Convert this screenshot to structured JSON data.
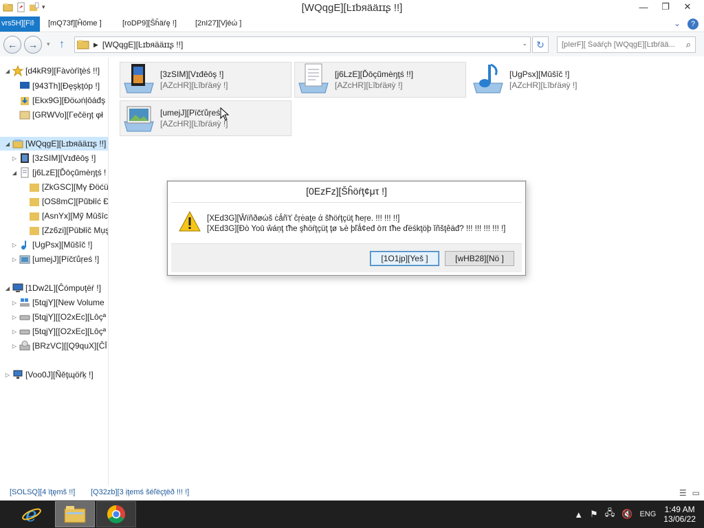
{
  "window": {
    "title": "[WQqgE][Ŀɪƅяääɪɪʂ !!]",
    "minimize_glyph": "—",
    "maximize_glyph": "❐",
    "close_glyph": "✕"
  },
  "ribbon": {
    "file_tab": "vrs5H][Fïŀ",
    "tabs": [
      "[mQ73f][Ĥömе ]",
      "[roDP9][Šĥäŕę !]",
      "[2nI27][Vĵéώ ]"
    ],
    "help_glyph": "?"
  },
  "nav": {
    "back_glyph": "←",
    "forward_glyph": "→",
    "up_glyph": "↑",
    "address_path": "[WQqgE][Ŀɪƅяääɪɪʂ !!]",
    "refresh_glyph": "↻",
    "search_placeholder": "[pIerF][ Šəäŕçĥ [WQqgE][Ŀɪƅŕää...",
    "search_icon_glyph": "⌕"
  },
  "tree": {
    "favorites": "[d4kR9][Fàvòŕîţèś !!]",
    "desktop": "[943Th][Ðęşķţóp !]",
    "downloads": "[Ekx9G][Ðöωṅļôáđş",
    "recent": "[GRWVo][Гečëŋț φł",
    "libraries": "[WQqgE][Ŀɪƅяääɪɪʂ !!]",
    "videos": "[3zSIM][Vɪđēōş !]",
    "documents": "[j6LzE][Ďōçũmèŋţś !",
    "my_docs": "[ZkGSC][Mγ Ðöćü",
    "public_docs": "[OS8mC][Pũƅłîć Ð",
    "my_music": "[AsnYx][Mỹ Mûšîc",
    "public_music": "[Zz6zi][Рūƅłîč Μụş",
    "music": "[UgPsx][Mŭšîč !]",
    "pictures": "[umejJ][Pïčťůŗeś !]",
    "computer": "[1Dw2L][Ĉómрυţёŕ !]",
    "drive1": "[5tqjY][New Volume",
    "drive2": "[5tqjY][[O2xEc][Lôçª",
    "drive3": "[5tqjY][[O2xEc][Lôçª",
    "drive4": "[BRzVC][[Q9quX][ĈĪ",
    "network": "[Voo0J][Ñěţɰöřķ !]"
  },
  "tiles": [
    {
      "name": "[3zSIM][Vɪđēōş !]",
      "sub": "[AZcHR][Ŀĭƅŕäяỳ !]",
      "icon": "videos-library-icon"
    },
    {
      "name": "[j6LzE][Ďōçũmèŋţś !!]",
      "sub": "[AZcHR][Ŀĭƅŕäяỳ !]",
      "icon": "documents-library-icon"
    },
    {
      "name": "[UgPsx][Mŭšîč !]",
      "sub": "[AZcHR][Ŀĭƅŕäяỳ !]",
      "icon": "music-library-icon"
    },
    {
      "name": "[umejJ][Pïčťůŗeś",
      "sub": "[AZcHR][Ŀĭƅŕäяỳ !]",
      "icon": "pictures-library-icon"
    }
  ],
  "status": {
    "items_count": "[SOLSQ][4 ïţęmš !!]",
    "selected_count": "[Q32zb][3 ịţemś šéľëçţëð !!! !]"
  },
  "dialog": {
    "title": "[0EzFz][Šĥöŕţ¢μτ !]",
    "line1": "[XEd3G][Ŵïñðøώš ċǻñ'ť ĉŗėaţe ά šħöŕţçüţ ħeŗe. !!! !!! !!]",
    "line2": "[XEd3G][Ðò Yoū ŵáņţ ťħе şħöŕţçüţ ţø ъè þľǻ¢еđ ōπ ťħе ďёśkţöþ ĭñšţêäđ? !!! !!! !!! !!! !]",
    "yes_label": "[1O1jp][Yeš ]",
    "no_label": "[wHB28][Nö ]"
  },
  "taskbar": {
    "tray_lang": "ENG",
    "time": "1:49 AM",
    "date": "13/06/22"
  },
  "colors": {
    "accent": "#1979ca",
    "selection": "#cce8ff",
    "taskbar": "#1f1f1f"
  }
}
